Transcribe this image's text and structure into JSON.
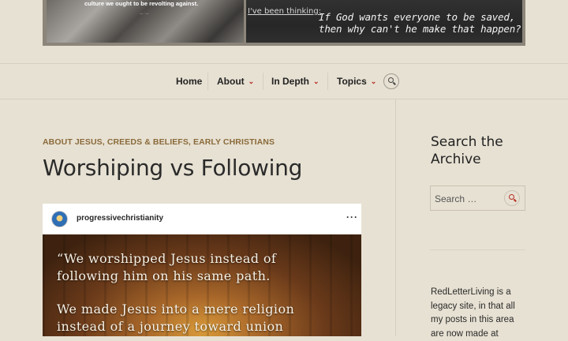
{
  "banner": {
    "left_text": "culture we ought to be revolting against.",
    "right_label": "I've been thinking:",
    "right_quote_line1": "If God wants everyone to be saved,",
    "right_quote_line2": "then why can't he make that happen?"
  },
  "nav": {
    "items": [
      {
        "label": "Home"
      },
      {
        "label": "About"
      },
      {
        "label": "In Depth"
      },
      {
        "label": "Topics"
      }
    ],
    "caret_icon": "chevron-down-icon",
    "search_icon": "search-icon",
    "accent": "#b52e25"
  },
  "post": {
    "categories": "ABOUT JESUS, CREEDS & BELIEFS, EARLY CHRISTIANS",
    "title": "Worshiping vs Following"
  },
  "embed": {
    "username": "progressivechristianity",
    "more": "···",
    "quote_lines": [
      "“We worshipped Jesus instead of",
      "following him on his same path.",
      "We made Jesus into a mere religion",
      "instead of a journey toward union"
    ]
  },
  "sidebar": {
    "search_title": "Search the Archive",
    "search_placeholder": "Search …",
    "about_text": "RedLetterLiving is a legacy site, in that all my posts in this area are now made at"
  },
  "colors": {
    "background": "#e7e1d3",
    "category": "#8a6a3a",
    "accent": "#b52e25"
  }
}
